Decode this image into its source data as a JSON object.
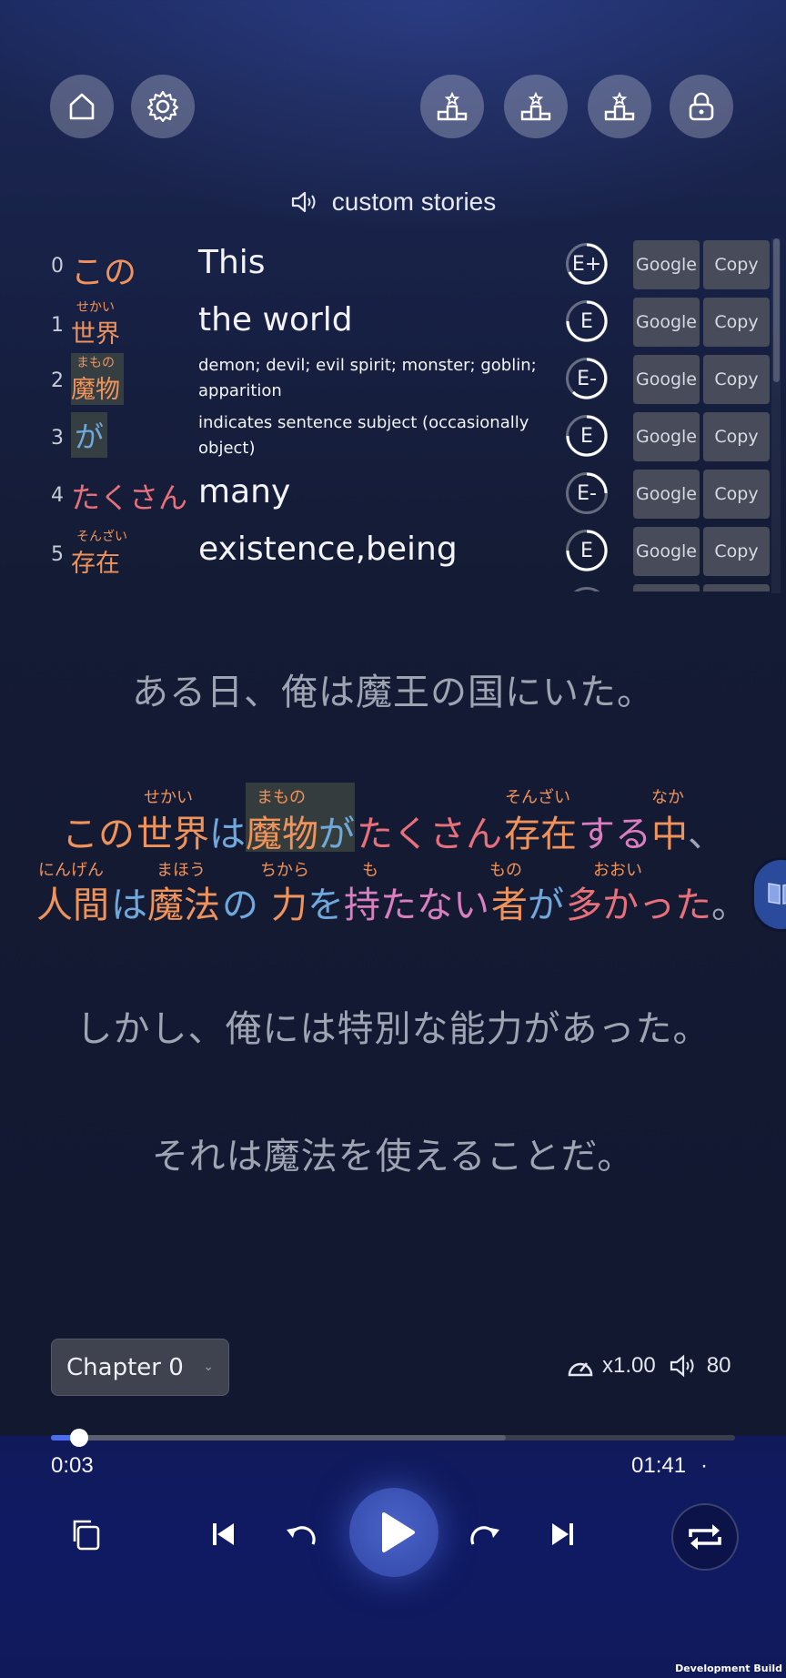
{
  "toolbar": {
    "icons": [
      "home-icon",
      "gear-icon",
      "podium-icon",
      "podium-icon",
      "podium-icon",
      "lock-icon"
    ]
  },
  "header": {
    "title": "custom stories",
    "icon": "speaker-icon"
  },
  "words": [
    {
      "index": "0",
      "reading": "",
      "word": "この",
      "meaning": "This",
      "level": "E+",
      "google": "Google",
      "copy": "Copy"
    },
    {
      "index": "1",
      "reading": "せかい",
      "word": "世界",
      "meaning": "the world",
      "level": "E",
      "google": "Google",
      "copy": "Copy"
    },
    {
      "index": "2",
      "reading": "まもの",
      "word": "魔物",
      "meaning": "demon; devil; evil spirit; monster; goblin; apparition",
      "level": "E-",
      "google": "Google",
      "copy": "Copy"
    },
    {
      "index": "3",
      "reading": "",
      "word": "が",
      "meaning": "indicates sentence subject (occasionally object)",
      "level": "E",
      "google": "Google",
      "copy": "Copy"
    },
    {
      "index": "4",
      "reading": "",
      "word": "たくさん",
      "meaning": "many",
      "level": "E-",
      "google": "Google",
      "copy": "Copy"
    },
    {
      "index": "5",
      "reading": "そんざい",
      "word": "存在",
      "meaning": "existence,being",
      "level": "E",
      "google": "Google",
      "copy": "Copy"
    }
  ],
  "story": {
    "line1": "ある日、俺は魔王の国にいた。",
    "active_line1": [
      {
        "text": "この",
        "ruby": ""
      },
      {
        "text": "世界",
        "ruby": "せかい"
      },
      {
        "text": "は",
        "ruby": ""
      },
      {
        "text": "魔物",
        "ruby": "まもの"
      },
      {
        "text": "が",
        "ruby": ""
      },
      {
        "text": "たくさん",
        "ruby": ""
      },
      {
        "text": "存在",
        "ruby": "そんざい"
      },
      {
        "text": "する",
        "ruby": ""
      },
      {
        "text": "中",
        "ruby": "なか"
      },
      {
        "text": "、",
        "ruby": ""
      }
    ],
    "active_line2": [
      {
        "text": "人間",
        "ruby": "にんげん"
      },
      {
        "text": "は",
        "ruby": ""
      },
      {
        "text": "魔法",
        "ruby": "まほう"
      },
      {
        "text": "の",
        "ruby": ""
      },
      {
        "text": "力",
        "ruby": "ちから"
      },
      {
        "text": "を",
        "ruby": ""
      },
      {
        "text": "持",
        "ruby": "も"
      },
      {
        "text": "たない",
        "ruby": ""
      },
      {
        "text": "者",
        "ruby": "もの"
      },
      {
        "text": "が",
        "ruby": ""
      },
      {
        "text": "多",
        "ruby": "おおい"
      },
      {
        "text": "かった",
        "ruby": ""
      },
      {
        "text": "。",
        "ruby": ""
      }
    ],
    "line3": "しかし、俺には特別な能力があった。",
    "line4": "それは魔法を使えることだ。"
  },
  "player": {
    "chapter": "Chapter 0",
    "speed": "x1.00",
    "volume": "80",
    "elapsed": "0:03",
    "total": "01:41",
    "dot": "·",
    "progress_fraction": 0.03,
    "buffered_fraction": 0.66
  },
  "footer": {
    "dev_build": "Development Build"
  },
  "colors": {
    "noun": "#f0935a",
    "particle": "#6fa8dc",
    "verb": "#d97fbf",
    "adverb": "#e8707a",
    "accent": "#4a6cf0"
  }
}
